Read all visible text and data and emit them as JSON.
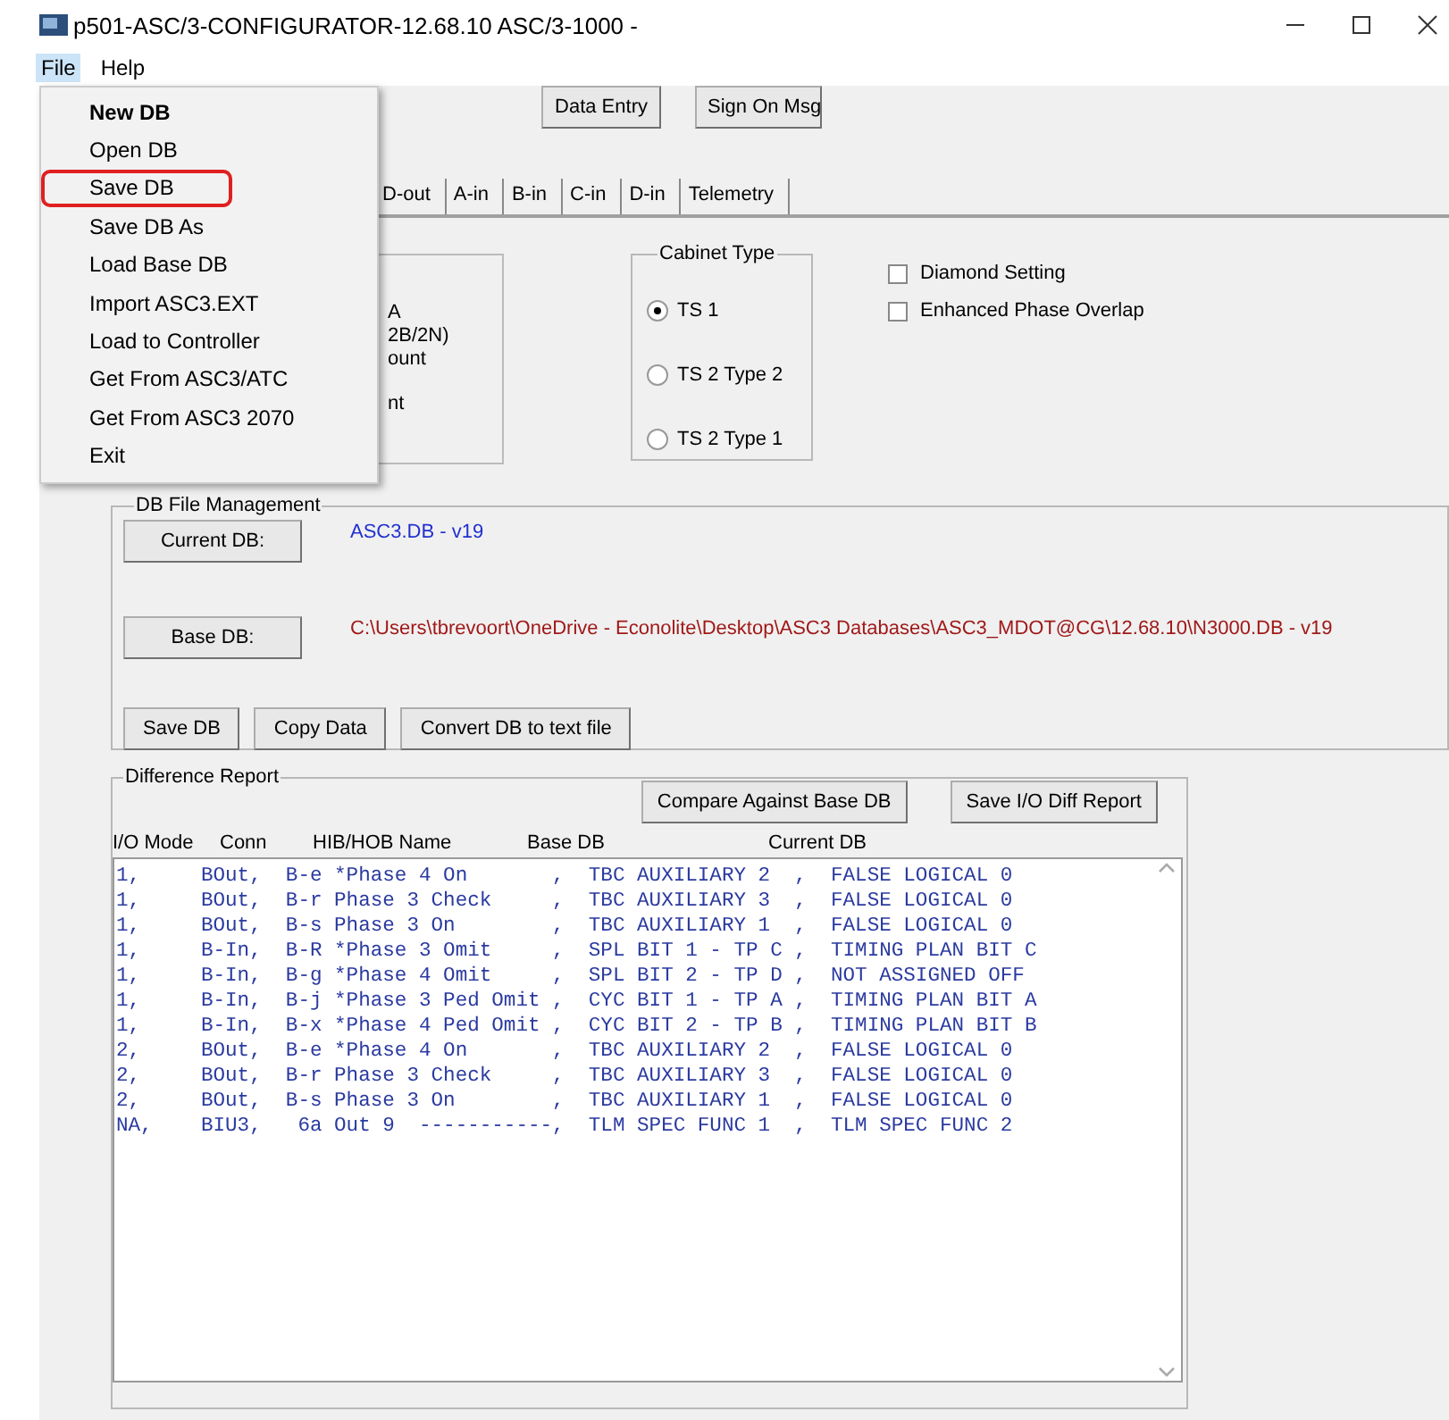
{
  "window": {
    "title": "p501-ASC/3-CONFIGURATOR-12.68.10 ASC/3-1000  -"
  },
  "menu_bar": [
    "File",
    "Help"
  ],
  "file_menu": {
    "open": true,
    "items": [
      {
        "label": "New DB",
        "default": true,
        "marked": false
      },
      {
        "label": "Open DB",
        "default": false,
        "marked": false
      },
      {
        "label": "Save DB",
        "default": false,
        "marked": true
      },
      {
        "label": "Save DB As",
        "default": false,
        "marked": false
      },
      {
        "label": "Load Base DB",
        "default": false,
        "marked": false
      },
      {
        "label": "Import ASC3.EXT",
        "default": false,
        "marked": false
      },
      {
        "label": "Load to Controller",
        "default": false,
        "marked": false
      },
      {
        "label": "Get From ASC3/ATC",
        "default": false,
        "marked": false
      },
      {
        "label": "Get From ASC3 2070",
        "default": false,
        "marked": false
      },
      {
        "label": "Exit",
        "default": false,
        "marked": false
      }
    ]
  },
  "top_buttons": [
    "Data Entry",
    "Sign On Msg"
  ],
  "tabs": [
    {
      "label": "D-out",
      "selected": false
    },
    {
      "label": "A-in",
      "selected": false
    },
    {
      "label": "B-in",
      "selected": false
    },
    {
      "label": "C-in",
      "selected": false
    },
    {
      "label": "D-in",
      "selected": false
    },
    {
      "label": "Telemetry",
      "selected": false
    }
  ],
  "hidden_panel": {
    "line_groups": [
      [
        "A",
        "2B/2N)",
        "ount"
      ],
      [
        "nt"
      ]
    ]
  },
  "cabinet_type": {
    "title": "Cabinet Type",
    "options": [
      {
        "label": "TS 1",
        "selected": true
      },
      {
        "label": "TS 2 Type 2",
        "selected": false
      },
      {
        "label": "TS 2 Type 1",
        "selected": false
      }
    ]
  },
  "options": [
    {
      "label": "Diamond Setting",
      "checked": false
    },
    {
      "label": "Enhanced Phase Overlap",
      "checked": false
    }
  ],
  "db_file_management": {
    "title": "DB File Management",
    "current_db": {
      "button": "Current DB:",
      "value": "ASC3.DB - v19"
    },
    "base_db": {
      "button": "Base DB:",
      "value": "C:\\Users\\tbrevoort\\OneDrive - Econolite\\Desktop\\ASC3 Databases\\ASC3_MDOT@CG\\12.68.10\\N3000.DB - v19"
    },
    "buttons": [
      "Save DB",
      "Copy Data",
      "Convert DB to text file"
    ]
  },
  "difference_report": {
    "title": "Difference Report",
    "buttons": [
      "Compare Against Base DB",
      "Save I/O Diff Report"
    ],
    "columns": [
      "I/O Mode",
      "Conn",
      "HIB/HOB Name",
      "Base DB",
      "Current DB"
    ],
    "rows": [
      "1,     BOut,  B-e *Phase 4 On       ,  TBC AUXILIARY 2  ,  FALSE LOGICAL 0",
      "1,     BOut,  B-r Phase 3 Check     ,  TBC AUXILIARY 3  ,  FALSE LOGICAL 0",
      "1,     BOut,  B-s Phase 3 On        ,  TBC AUXILIARY 1  ,  FALSE LOGICAL 0",
      "1,     B-In,  B-R *Phase 3 Omit     ,  SPL BIT 1 - TP C ,  TIMING PLAN BIT C",
      "1,     B-In,  B-g *Phase 4 Omit     ,  SPL BIT 2 - TP D ,  NOT ASSIGNED OFF",
      "1,     B-In,  B-j *Phase 3 Ped Omit ,  CYC BIT 1 - TP A ,  TIMING PLAN BIT A",
      "1,     B-In,  B-x *Phase 4 Ped Omit ,  CYC BIT 2 - TP B ,  TIMING PLAN BIT B",
      "2,     BOut,  B-e *Phase 4 On       ,  TBC AUXILIARY 2  ,  FALSE LOGICAL 0",
      "2,     BOut,  B-r Phase 3 Check     ,  TBC AUXILIARY 3  ,  FALSE LOGICAL 0",
      "2,     BOut,  B-s Phase 3 On        ,  TBC AUXILIARY 1  ,  FALSE LOGICAL 0",
      "NA,    BIU3,   6a Out 9  -----------,  TLM SPEC FUNC 1  ,  TLM SPEC FUNC 2"
    ]
  }
}
